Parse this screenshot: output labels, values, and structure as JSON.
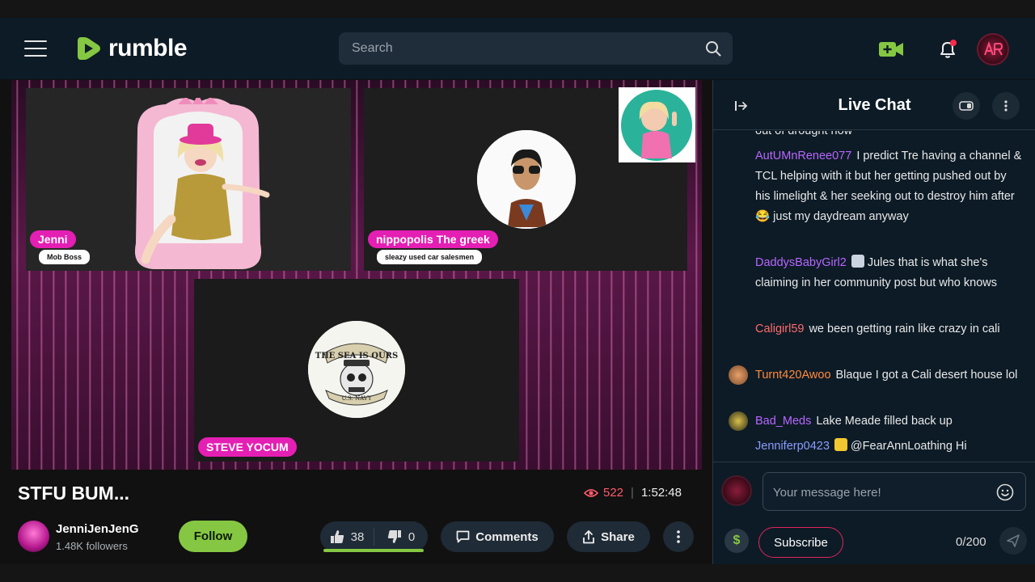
{
  "header": {
    "logo_text": "rumble",
    "search_placeholder": "Search",
    "brand_color": "#85c742",
    "icons": [
      "hamburger-menu-icon",
      "search-icon",
      "go-live-camera-icon",
      "notification-bell-icon",
      "user-avatar"
    ]
  },
  "video": {
    "participants": [
      {
        "name": "Jenni",
        "subtitle": "Mob Boss"
      },
      {
        "name": "nippopolis The greek",
        "subtitle": "sleazy used car salesmen"
      },
      {
        "name": "STEVE YOCUM",
        "subtitle": ""
      }
    ],
    "badge_text": "THE SEA IS OURS",
    "badge_sub": "U.S. NAVY"
  },
  "info": {
    "title": "STFU BUM...",
    "views": "522",
    "duration": "1:52:48",
    "channel_name": "JenniJenJenG",
    "followers": "1.48K followers",
    "follow_label": "Follow",
    "likes": "38",
    "dislikes": "0",
    "comments_label": "Comments",
    "share_label": "Share"
  },
  "chat": {
    "title": "Live Chat",
    "partial_line": "out of drought now",
    "messages": [
      {
        "user": "AutUMnRenee077",
        "color": "#b866ff",
        "text": "I predict Tre having a channel & TCL helping with it but her getting pushed out by his limelight & her seeking out to destroy him after",
        "emoji": "😂",
        "tail": "just my daydream anyway"
      },
      {
        "user": "DaddysBabyGirl2",
        "color": "#b866ff",
        "text": "Jules that is what she's claiming in her community post but who knows"
      },
      {
        "user": "Caligirl59",
        "color": "#ff6b6b",
        "text": "we been getting rain like crazy in cali"
      },
      {
        "user": "Turnt420Awoo",
        "color": "#ff8a3d",
        "text": "Blaque I got a Cali desert house lol"
      },
      {
        "user": "Bad_Meds",
        "color": "#b866ff",
        "text": "Lake Meade filled back up"
      },
      {
        "user": "Jenniferp0423",
        "color": "#8a9cff",
        "text": "@FearAnnLoathing Hi"
      }
    ],
    "input_placeholder": "Your message here!",
    "subscribe_label": "Subscribe",
    "char_count": "0/200",
    "rant_symbol": "$"
  }
}
